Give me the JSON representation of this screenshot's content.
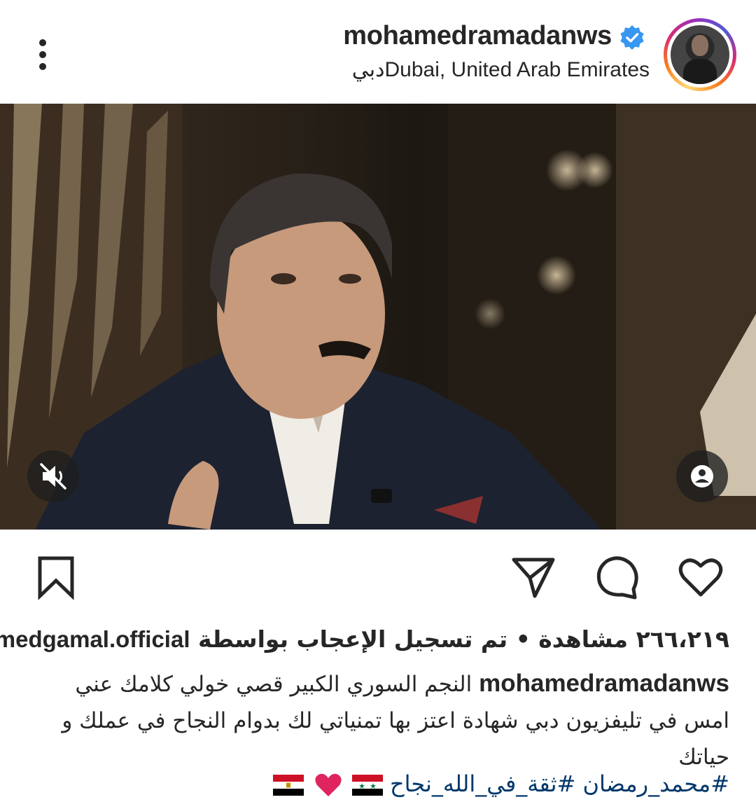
{
  "post": {
    "username": "mohamedramadanws",
    "verified": true,
    "location": "Dubai, United Arab Emirates",
    "location_prefix": "دبي"
  },
  "media": {
    "type": "video",
    "muted": true
  },
  "actions": {
    "like_icon": "heart-icon",
    "comment_icon": "comment-icon",
    "share_icon": "send-icon",
    "save_icon": "bookmark-icon"
  },
  "likes": {
    "count_text": "٢٦٦،٢١٩ مشاهدة",
    "separator": "•",
    "liked_by_text": "تم تسجيل الإعجاب بواسطة",
    "liked_by_user": "hmedgamal.official"
  },
  "caption": {
    "username": "mohamedramadanws",
    "text": "النجم السوري الكبير قصي خولي كلامك عني امس في تليفزيون دبي شهادة اعتز بها تمنياتي لك بدوام النجاح في عملك و حياتك"
  },
  "hashtags": {
    "tag1": "#محمد_رمضان",
    "tag2": "#ثقة_في_الله_نجاح"
  },
  "colors": {
    "verified_blue": "#3897f0",
    "hashtag": "#00376b",
    "heart_red": "#e0245e"
  }
}
